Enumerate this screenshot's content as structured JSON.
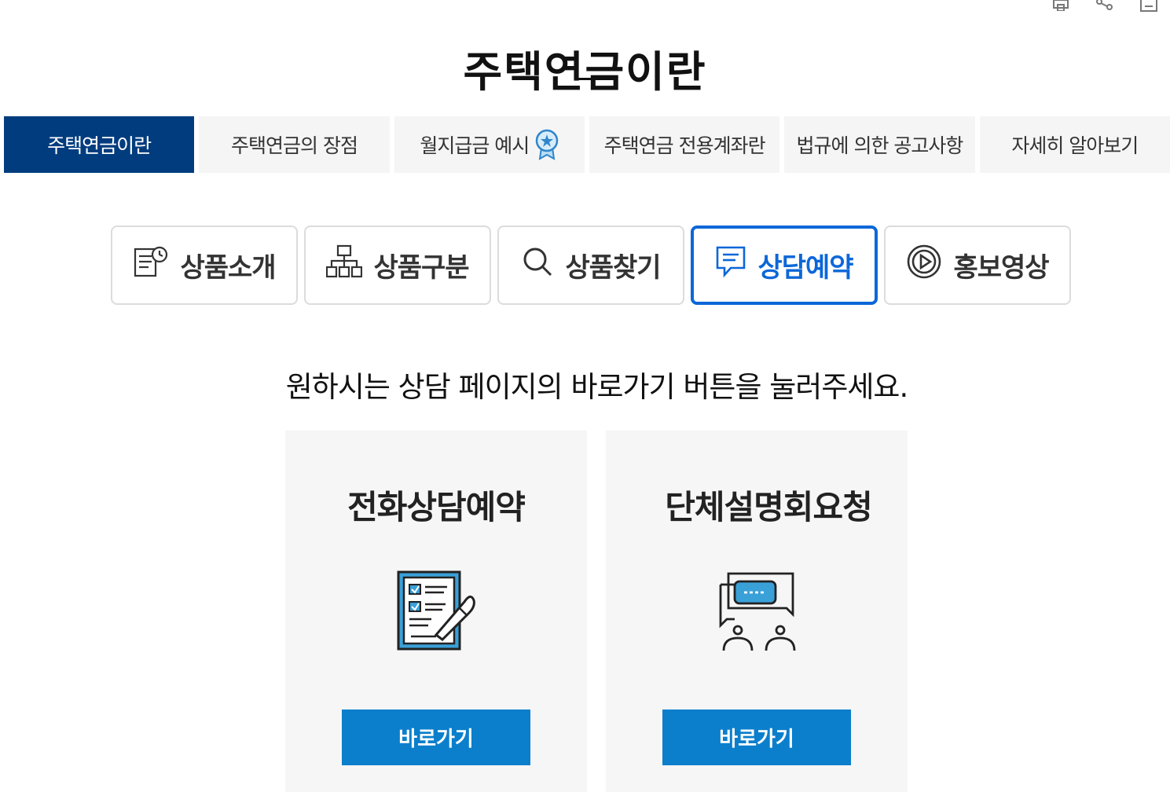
{
  "page": {
    "title": "주택연금이란"
  },
  "utility_icons": [
    "print-icon",
    "share-icon",
    "bookmark-icon"
  ],
  "tabs": [
    {
      "label": "주택연금이란",
      "active": true
    },
    {
      "label": "주택연금의 장점",
      "active": false
    },
    {
      "label": "월지급금 예시",
      "active": false,
      "icon": "ribbon-badge-icon"
    },
    {
      "label": "주택연금 전용계좌란",
      "active": false
    },
    {
      "label": "법규에 의한 공고사항",
      "active": false
    },
    {
      "label": "자세히 알아보기",
      "active": false
    }
  ],
  "subnav": [
    {
      "label": "상품소개",
      "icon": "document-clock-icon",
      "active": false
    },
    {
      "label": "상품구분",
      "icon": "org-chart-icon",
      "active": false
    },
    {
      "label": "상품찾기",
      "icon": "search-icon",
      "active": false
    },
    {
      "label": "상담예약",
      "icon": "chat-document-icon",
      "active": true
    },
    {
      "label": "홍보영상",
      "icon": "play-circle-icon",
      "active": false
    }
  ],
  "instruction": "원하시는 상담 페이지의 바로가기 버튼을 눌러주세요.",
  "cards": [
    {
      "title": "전화상담예약",
      "icon": "checklist-phone-icon",
      "button_label": "바로가기"
    },
    {
      "title": "단체설명회요청",
      "icon": "group-chat-icon",
      "button_label": "바로가기"
    }
  ],
  "colors": {
    "tab_active": "#003c7e",
    "subnav_active": "#0c67d8",
    "button": "#0b7fcc",
    "card_bg": "#f6f6f6"
  }
}
